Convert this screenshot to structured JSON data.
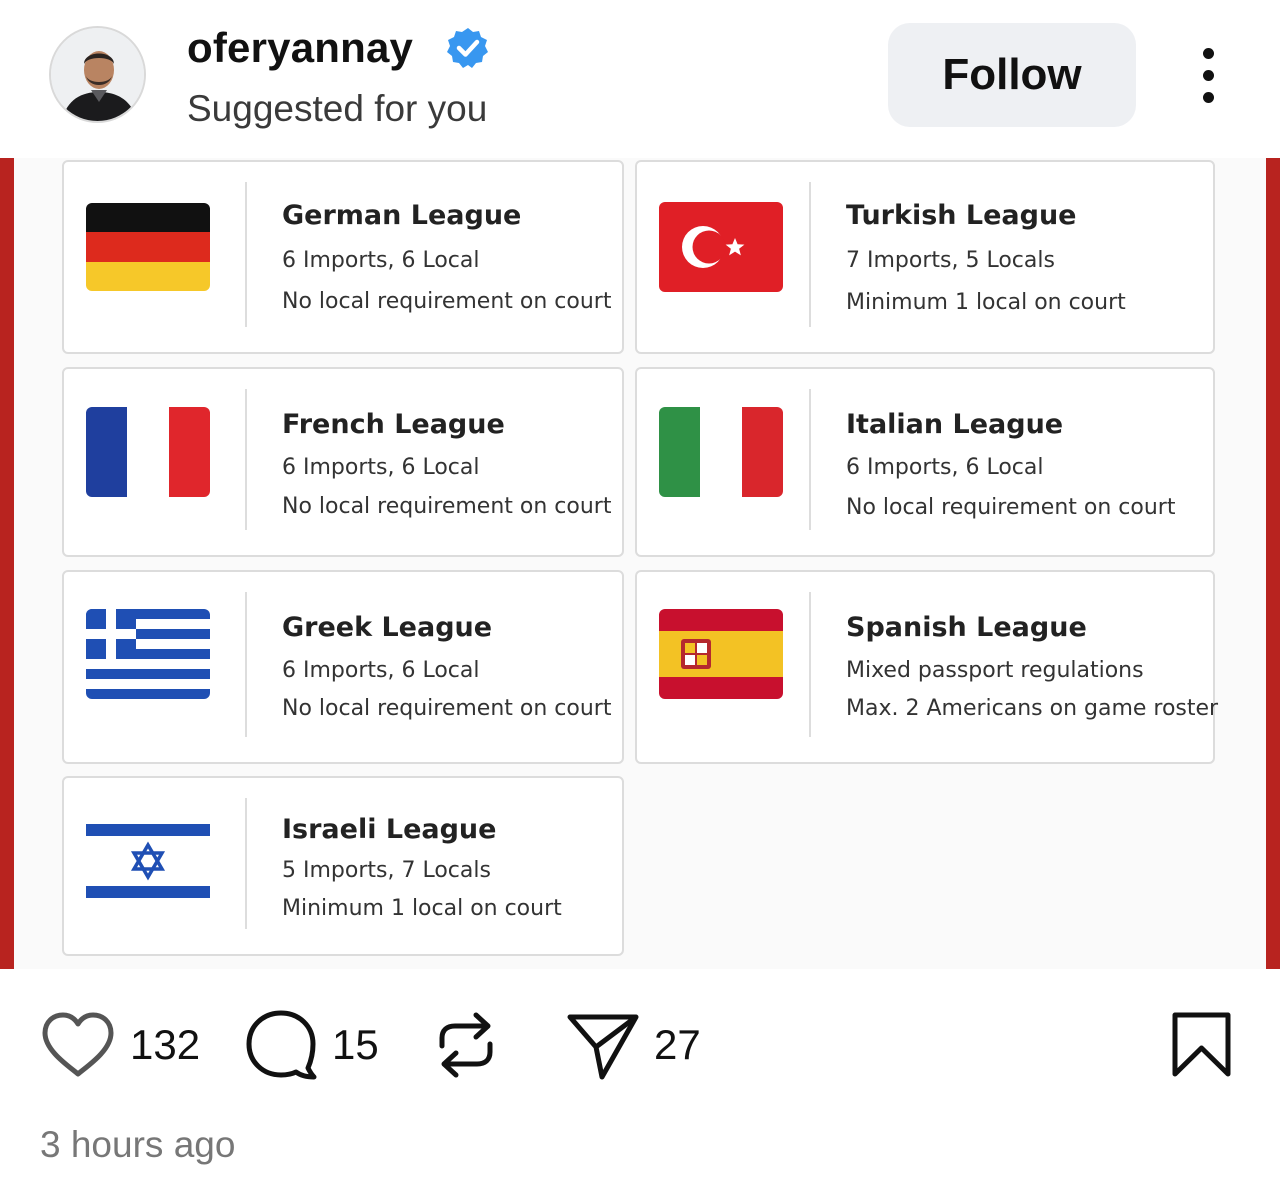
{
  "post": {
    "username": "oferyannay",
    "subtitle": "Suggested for you",
    "follow_label": "Follow",
    "timestamp": "3 hours ago"
  },
  "leagues": [
    {
      "name": "German League",
      "line1": "6 Imports, 6 Local",
      "line2": "No local requirement on court",
      "flag": "germany-flag"
    },
    {
      "name": "Turkish League",
      "line1": "7 Imports, 5 Locals",
      "line2": "Minimum 1 local on court",
      "flag": "turkey-flag"
    },
    {
      "name": "French League",
      "line1": "6 Imports, 6 Local",
      "line2": "No local requirement on court",
      "flag": "france-flag"
    },
    {
      "name": "Italian League",
      "line1": "6 Imports, 6 Local",
      "line2": "No local requirement on court",
      "flag": "italy-flag"
    },
    {
      "name": "Greek League",
      "line1": "6 Imports, 6 Local",
      "line2": "No local requirement on court",
      "flag": "greece-flag"
    },
    {
      "name": "Spanish League",
      "line1": "Mixed passport regulations",
      "line2": "Max. 2 Americans on game roster",
      "flag": "spain-flag"
    },
    {
      "name": "Israeli League",
      "line1": "5 Imports, 7 Locals",
      "line2": "Minimum 1 local on court",
      "flag": "israel-flag"
    }
  ],
  "actions": {
    "likes": "132",
    "comments": "15",
    "shares": "27"
  },
  "colors": {
    "accent_red": "#b8231f",
    "verified_blue": "#3897f0"
  }
}
